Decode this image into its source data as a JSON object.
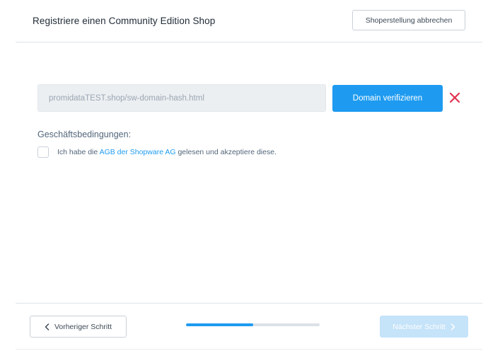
{
  "header": {
    "title": "Registriere einen Community Edition Shop",
    "cancel_label": "Shoperstellung abbrechen"
  },
  "domain": {
    "value": "promidataTEST.shop/sw-domain-hash.html",
    "verify_label": "Domain verifizieren",
    "remove_icon": "close-icon",
    "remove_color": "#e0314f"
  },
  "terms": {
    "heading": "Geschäftsbedingungen:",
    "checked": false,
    "text_before": "Ich habe die ",
    "link_text": "AGB der Shopware AG",
    "text_after": " gelesen und akzeptiere diese."
  },
  "footer": {
    "prev_label": "Vorheriger Schritt",
    "next_label": "Nächster Schritt",
    "next_enabled": false,
    "progress": 0.5
  },
  "colors": {
    "accent": "#1e9bf0",
    "accent_disabled": "#c5e3f9"
  }
}
